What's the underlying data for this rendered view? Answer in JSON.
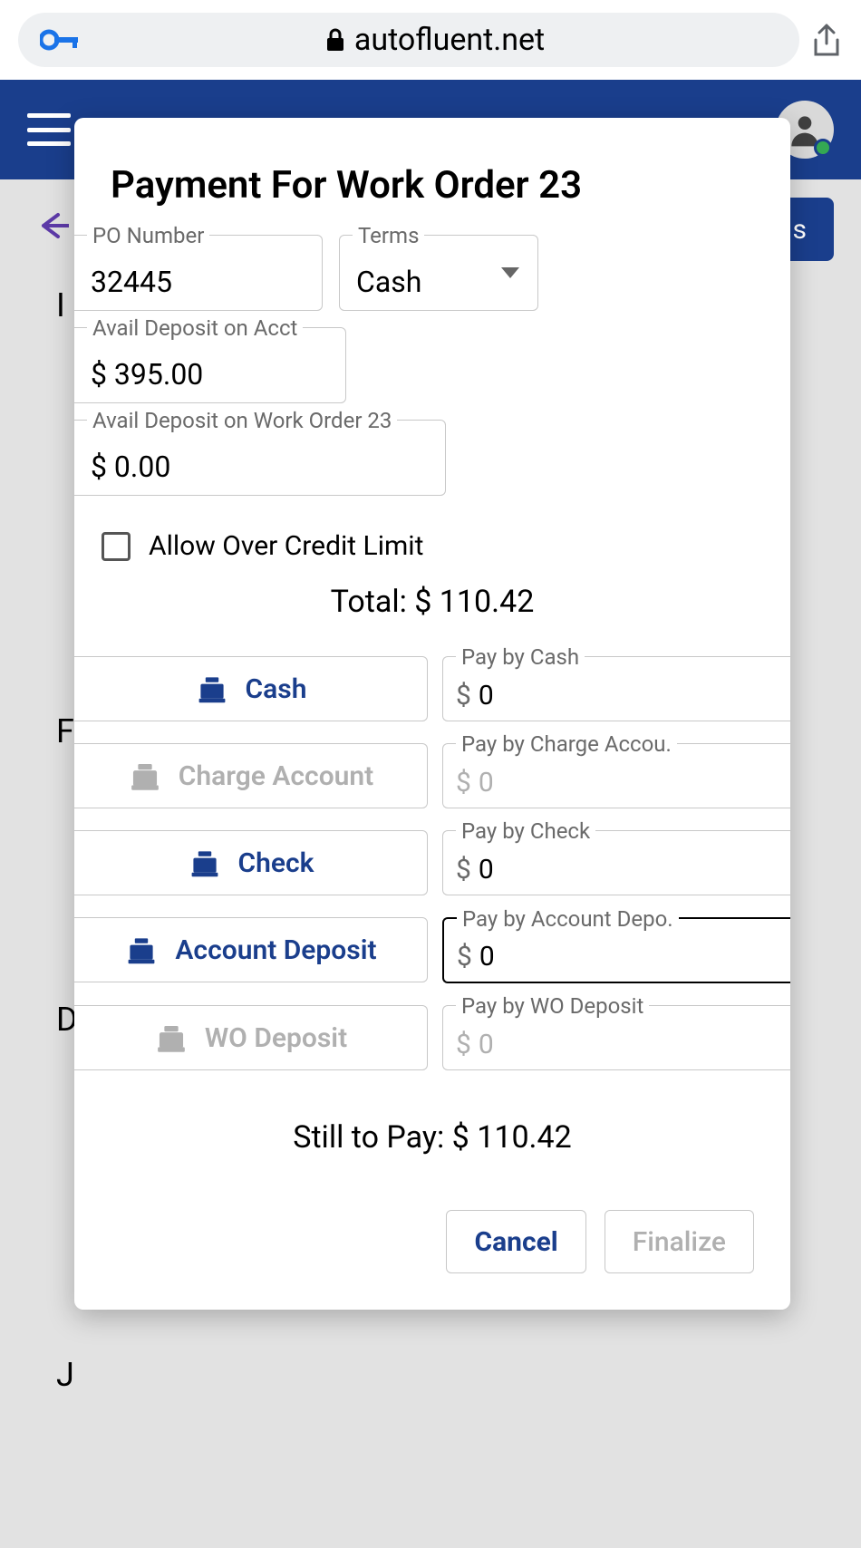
{
  "browser": {
    "domain": "autofluent.net"
  },
  "nav": {
    "bg_button_suffix": "s"
  },
  "bg_letters": {
    "l1": "I",
    "l2": "F",
    "l3": "D",
    "l4": "J"
  },
  "modal": {
    "title": "Payment For Work Order 23",
    "fields": {
      "po_number": {
        "label": "PO Number",
        "value": "32445"
      },
      "terms": {
        "label": "Terms",
        "value": "Cash"
      },
      "avail_acct": {
        "label": "Avail Deposit on Acct",
        "value": "$ 395.00"
      },
      "avail_wo": {
        "label": "Avail Deposit on Work Order 23",
        "value": "$ 0.00"
      }
    },
    "allow_over_label": "Allow Over Credit Limit",
    "total_label": "Total: $ 110.42",
    "methods": {
      "cash": {
        "btn": "Cash",
        "label": "Pay by Cash",
        "value": "0"
      },
      "charge": {
        "btn": "Charge Account",
        "label": "Pay by Charge Accou.",
        "value": "0"
      },
      "check": {
        "btn": "Check",
        "label": "Pay by Check",
        "value": "0"
      },
      "acct_deposit": {
        "btn": "Account Deposit",
        "label": "Pay by Account Depo.",
        "value": "0"
      },
      "wo_deposit": {
        "btn": "WO Deposit",
        "label": "Pay by WO Deposit",
        "value": "0"
      }
    },
    "still_label": "Still to Pay: $ 110.42",
    "cancel": "Cancel",
    "finalize": "Finalize"
  }
}
